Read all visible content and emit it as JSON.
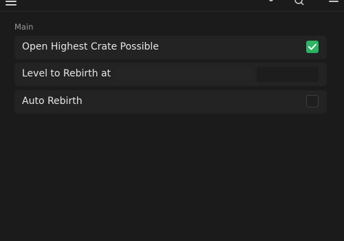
{
  "titlebar": {
    "title": "",
    "menu_icon": "hamburger-menu-icon",
    "action_icons": [
      "dot-icon",
      "search-icon",
      "minimize-icon"
    ]
  },
  "section": {
    "label": "Main"
  },
  "rows": [
    {
      "label": "Open Highest Crate Possible",
      "control": "toggle",
      "checked": true
    },
    {
      "label": "Level to Rebirth at",
      "control": "input",
      "value": ""
    },
    {
      "label": "Auto Rebirth",
      "control": "toggle",
      "checked": false
    }
  ],
  "colors": {
    "background": "#1b1b1b",
    "row": "#232323",
    "accent": "#2bb463",
    "text": "#e6e6e6",
    "muted": "#9a9a9a"
  }
}
